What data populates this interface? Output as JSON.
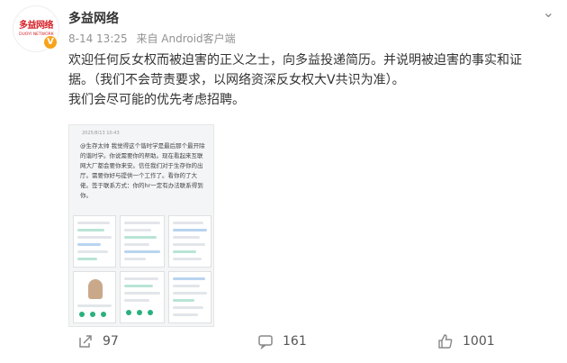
{
  "account": {
    "name": "多益网络",
    "logo_text": "多益网络",
    "logo_sub": "DUOYI NETWORK",
    "verified_icon": "verified-badge-icon"
  },
  "post": {
    "date": "8-14 13:25",
    "source": "来自 Android客户端",
    "paragraph1": "欢迎任何反女权而被迫害的正义之士，向多益投递简历。并说明被迫害的事实和证据。（我们不会苛责要求，以网络资深反女权大V共识为准）。",
    "paragraph2": "我们会尽可能的优先考虑招聘。"
  },
  "image": {
    "date": "2025/8/13 10:43",
    "text": "@生存太帅 我觉得这个谐时学是最后那个最开除的谐时学。你说需要你的帮助。现在看起来互联网大厂都会要你来安。信任我们对于生存你的出厅。需要你好与提供一个工作了。看你的了大佬。签于联系方式：你的hr一定有办法联系得到你。"
  },
  "actions": {
    "share": {
      "count": "97",
      "icon": "share-icon"
    },
    "comment": {
      "count": "161",
      "icon": "comment-icon"
    },
    "like": {
      "count": "1001",
      "icon": "thumbs-up-icon"
    }
  },
  "colors": {
    "accent": "#d6242a",
    "badge": "#f7a31c"
  }
}
